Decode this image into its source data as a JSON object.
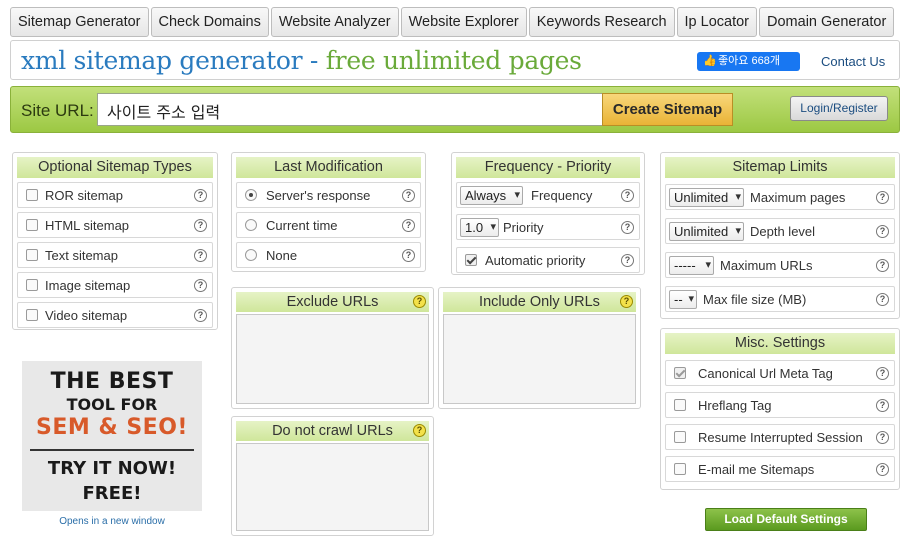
{
  "tabs": [
    "Sitemap Generator",
    "Check Domains",
    "Website Analyzer",
    "Website Explorer",
    "Keywords Research",
    "Ip Locator",
    "Domain Generator"
  ],
  "header": {
    "title_part1": "xml sitemap generator - ",
    "title_part2": "free unlimited pages",
    "like_label": "좋아요 668개",
    "contact": "Contact Us"
  },
  "url_bar": {
    "label": "Site URL:",
    "placeholder": "사이트 주소 입력",
    "create_button": "Create Sitemap",
    "login_button": "Login/Register"
  },
  "sitemap_types": {
    "title": "Optional Sitemap Types",
    "items": [
      {
        "label": "ROR sitemap",
        "checked": false
      },
      {
        "label": "HTML sitemap",
        "checked": false
      },
      {
        "label": "Text sitemap",
        "checked": false
      },
      {
        "label": "Image sitemap",
        "checked": false
      },
      {
        "label": "Video sitemap",
        "checked": false
      }
    ]
  },
  "last_modification": {
    "title": "Last Modification",
    "options": [
      {
        "label": "Server's response",
        "selected": true
      },
      {
        "label": "Current time",
        "selected": false
      },
      {
        "label": "None",
        "selected": false
      }
    ]
  },
  "frequency_priority": {
    "title": "Frequency - Priority",
    "frequency_value": "Always",
    "frequency_label": "Frequency",
    "priority_value": "1.0",
    "priority_label": "Priority",
    "auto_priority_label": "Automatic priority",
    "auto_priority_checked": true
  },
  "sitemap_limits": {
    "title": "Sitemap Limits",
    "max_pages_value": "Unlimited",
    "max_pages_label": "Maximum pages",
    "depth_value": "Unlimited",
    "depth_label": "Depth level",
    "max_urls_value": "-----",
    "max_urls_label": "Maximum URLs",
    "max_size_value": "--",
    "max_size_label": "Max file size (MB)"
  },
  "exclude_urls": {
    "title": "Exclude URLs"
  },
  "include_only_urls": {
    "title": "Include Only URLs"
  },
  "do_not_crawl": {
    "title": "Do not crawl URLs"
  },
  "misc_settings": {
    "title": "Misc. Settings",
    "items": [
      {
        "label": "Canonical Url Meta Tag",
        "checked": true
      },
      {
        "label": "Hreflang Tag",
        "checked": false
      },
      {
        "label": "Resume Interrupted Session",
        "checked": false
      },
      {
        "label": "E-mail me Sitemaps",
        "checked": false
      }
    ]
  },
  "ad": {
    "line1": "THE BEST",
    "line2": "TOOL FOR",
    "line3": "SEM & SEO!",
    "line4": "TRY IT NOW!",
    "line5": "FREE!",
    "link": "Opens in a new window"
  },
  "load_defaults_button": "Load Default Settings",
  "help_icon_text": "?",
  "colors": {
    "accent_blue": "#2a7bbf",
    "accent_green": "#6aaa3a",
    "bar_green": "#9cc843",
    "ad_orange": "#d85a2a"
  }
}
